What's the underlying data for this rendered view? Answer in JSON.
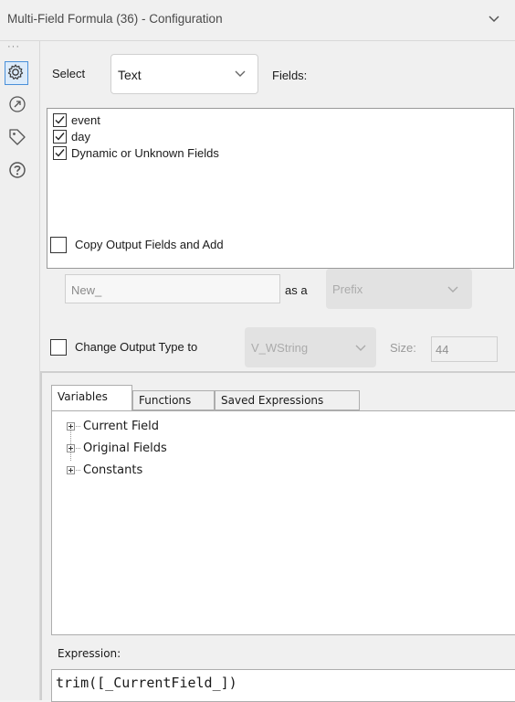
{
  "window": {
    "title": "Multi-Field Formula (36) - Configuration"
  },
  "rail": {
    "dots": "···",
    "icons": [
      "gear-icon",
      "anchor-icon",
      "tag-icon",
      "help-icon"
    ]
  },
  "config": {
    "select_label": "Select",
    "select_value": "Text",
    "fields_label": "Fields:",
    "fields": [
      {
        "label": "event",
        "checked": true
      },
      {
        "label": "day",
        "checked": true
      },
      {
        "label": "Dynamic or Unknown Fields",
        "checked": true
      }
    ],
    "copy_output_label": "Copy Output Fields and Add",
    "copy_output_checked": false,
    "affix_value": "New_",
    "as_a_label": "as a",
    "affix_type": "Prefix",
    "change_type_label": "Change Output Type to",
    "change_type_checked": false,
    "output_type": "V_WString",
    "size_label": "Size:",
    "size_value": "44"
  },
  "editor": {
    "tabs": [
      {
        "label": "Variables",
        "active": true
      },
      {
        "label": "Functions",
        "active": false
      },
      {
        "label": "Saved Expressions",
        "active": false
      }
    ],
    "tree": [
      {
        "label": "Current Field"
      },
      {
        "label": "Original Fields"
      },
      {
        "label": "Constants"
      }
    ],
    "expression_label": "Expression:",
    "expression": "trim([_CurrentField_])"
  },
  "colors": {
    "accent": "#4a90d9",
    "panel_bg": "#f0f0f0",
    "disabled_bg": "#e2e2e2"
  }
}
